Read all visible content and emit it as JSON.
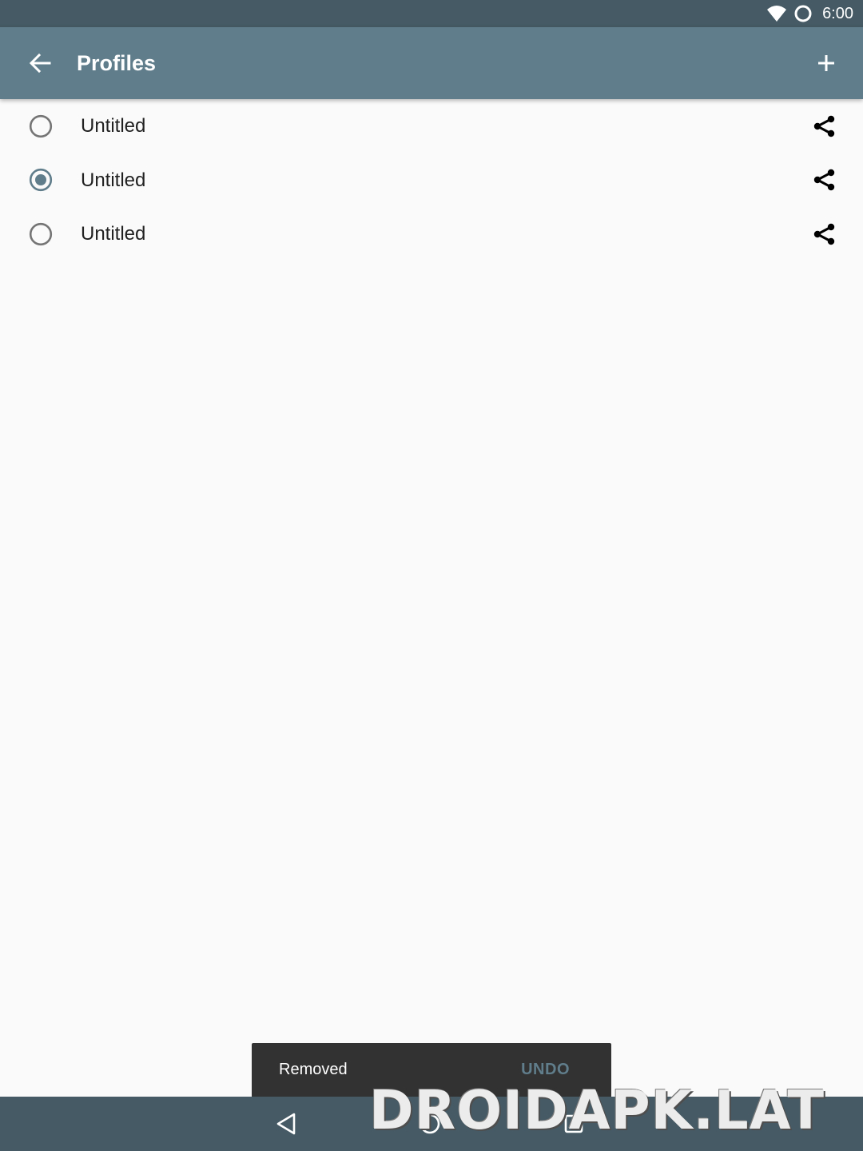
{
  "status_bar": {
    "time": "6:00",
    "icons": [
      "wifi-icon",
      "sync-circle-icon"
    ]
  },
  "app_bar": {
    "title": "Profiles",
    "back_icon": "arrow-left-icon",
    "action_icon": "plus-icon",
    "color": "#607d8b"
  },
  "profiles": [
    {
      "label": "Untitled",
      "selected": false
    },
    {
      "label": "Untitled",
      "selected": true
    },
    {
      "label": "Untitled",
      "selected": false
    }
  ],
  "snackbar": {
    "message": "Removed",
    "action": "UNDO"
  },
  "nav_bar": {
    "buttons": [
      "back-triangle-icon",
      "home-circle-icon",
      "recents-square-icon"
    ]
  },
  "watermark": {
    "text": "DROIDAPK.LAT"
  },
  "colors": {
    "status_bar": "#455a64",
    "accent": "#607d8b",
    "background": "#fafafa"
  }
}
